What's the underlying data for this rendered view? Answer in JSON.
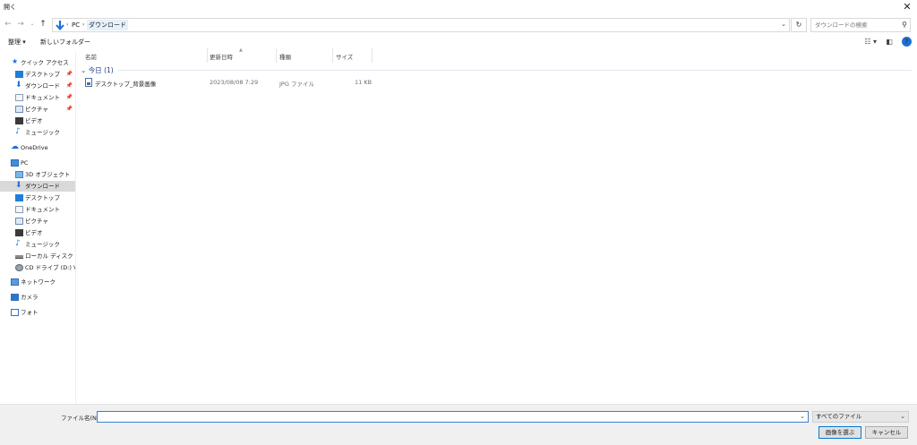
{
  "window": {
    "title": "開く",
    "close_glyph": "✕"
  },
  "address": {
    "crumbs": [
      "PC",
      "ダウンロード"
    ],
    "separator": "›",
    "search_placeholder": "ダウンロードの検索"
  },
  "toolbar": {
    "organize_label": "整理 ▾",
    "new_folder_label": "新しいフォルダー"
  },
  "sidebar": {
    "quick_access": "クイック アクセス",
    "quick_items": [
      "デスクトップ",
      "ダウンロード",
      "ドキュメント",
      "ピクチャ",
      "ビデオ",
      "ミュージック"
    ],
    "onedrive": "OneDrive",
    "pc": "PC",
    "pc_items": [
      "3D オブジェクト",
      "ダウンロード",
      "デスクトップ",
      "ドキュメント",
      "ピクチャ",
      "ビデオ",
      "ミュージック",
      "ローカル ディスク (C:)",
      "CD ドライブ (D:) Virtu"
    ],
    "network": "ネットワーク",
    "camera": "カメラ",
    "photos": "フォト"
  },
  "columns": {
    "name": "名前",
    "modified": "更新日時",
    "type": "種類",
    "size": "サイズ"
  },
  "group": {
    "label": "今日 (1)"
  },
  "files": [
    {
      "name": "デスクトップ_背景画像",
      "modified": "2023/08/08 7:29",
      "type": "JPG ファイル",
      "size": "11 KB"
    }
  ],
  "bottom": {
    "filename_label": "ファイル名(N):",
    "filename_value": "",
    "filetype_selected": "すべてのファイル",
    "open_button": "画像を選ぶ",
    "cancel_button": "キャンセル"
  },
  "colors": {
    "accent": "#0078d7",
    "selected": "#d9d9d9",
    "folder_blue": "#1e6fd9"
  }
}
